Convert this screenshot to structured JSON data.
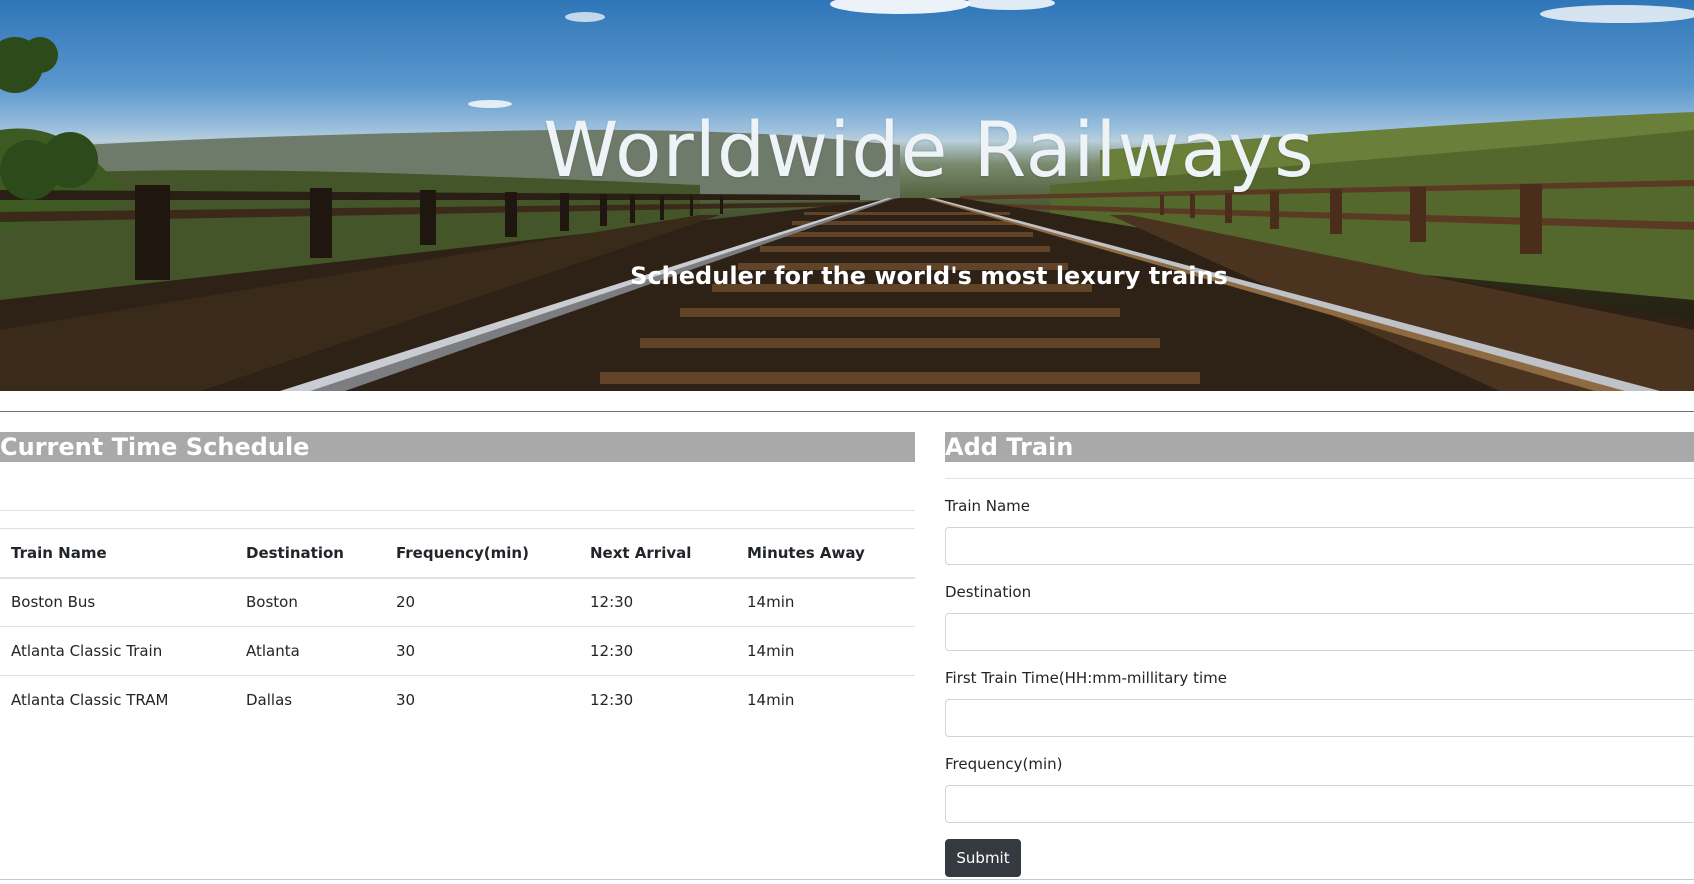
{
  "hero": {
    "title": "Worldwide Railways",
    "subtitle": "Scheduler for the world's most lexury trains"
  },
  "schedule": {
    "heading": "Current Time Schedule",
    "columns": [
      "Train Name",
      "Destination",
      "Frequency(min)",
      "Next Arrival",
      "Minutes Away"
    ],
    "rows": [
      [
        "Boston Bus",
        "Boston",
        "20",
        "12:30",
        "14min"
      ],
      [
        "Atlanta Classic Train",
        "Atlanta",
        "30",
        "12:30",
        "14min"
      ],
      [
        "Atlanta Classic TRAM",
        "Dallas",
        "30",
        "12:30",
        "14min"
      ]
    ]
  },
  "add_train": {
    "heading": "Add Train",
    "fields": {
      "train_name": {
        "label": "Train Name",
        "value": ""
      },
      "destination": {
        "label": "Destination",
        "value": ""
      },
      "first_train_time": {
        "label": "First Train Time(HH:mm-millitary time",
        "value": ""
      },
      "frequency": {
        "label": "Frequency(min)",
        "value": ""
      }
    },
    "submit_label": "Submit"
  },
  "colors": {
    "panel_heading_bg": "#a9a9a9",
    "submit_bg": "#343a40"
  }
}
